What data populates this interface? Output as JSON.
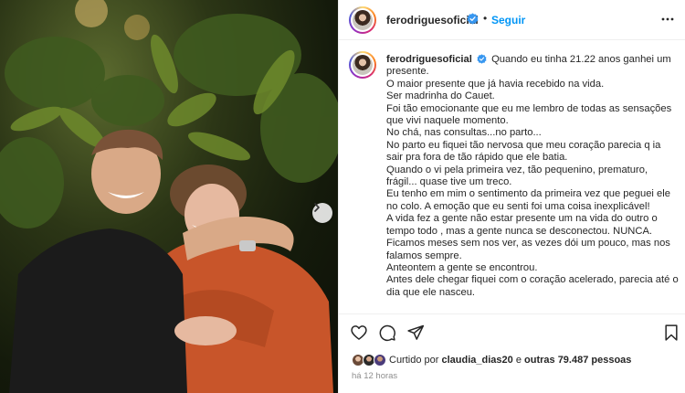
{
  "post": {
    "username": "ferodriguesoficial",
    "follow_label": "Seguir",
    "separator": "•",
    "caption_lines": [
      "Quando eu tinha 21.22 anos ganhei um presente.",
      "O maior presente que já havia recebido na vida.",
      "Ser madrinha do Cauet.",
      "Foi tão emocionante que eu me lembro de todas as sensações que vivi naquele momento.",
      "No chá, nas consultas...no parto...",
      "No parto eu fiquei tão nervosa que meu coração parecia q ia sair pra fora de tão rápido que ele batia.",
      "Quando o vi pela primeira vez, tão pequenino, prematuro, frágil... quase tive um treco.",
      "Eu tenho em mim o sentimento da primeira vez que peguei ele no colo. A emoção que eu senti foi uma coisa inexplicável!",
      "A vida fez a gente não estar presente um na vida do outro o tempo todo , mas a gente nunca se desconectou. NUNCA.",
      "Ficamos meses sem nos ver, as vezes dói um pouco, mas nos falamos sempre.",
      "Anteontem a gente se encontrou.",
      "Antes dele chegar fiquei com o coração acelerado, parecia até o dia que ele nasceu."
    ],
    "likes": {
      "prefix": "Curtido por",
      "user": "claudia_dias20",
      "middle": "e",
      "others": "outras 79.487 pessoas"
    },
    "time_ago": "há 12 horas"
  },
  "icons": {
    "verified": "verified-badge-icon",
    "more": "more-options-icon",
    "like": "heart-icon",
    "comment": "comment-icon",
    "share": "share-icon",
    "save": "bookmark-icon",
    "next": "chevron-right-icon"
  },
  "colors": {
    "link_blue": "#0095f6",
    "text": "#262626",
    "muted": "#8e8e8e",
    "verified_blue": "#3897f0",
    "divider": "#efefef"
  }
}
